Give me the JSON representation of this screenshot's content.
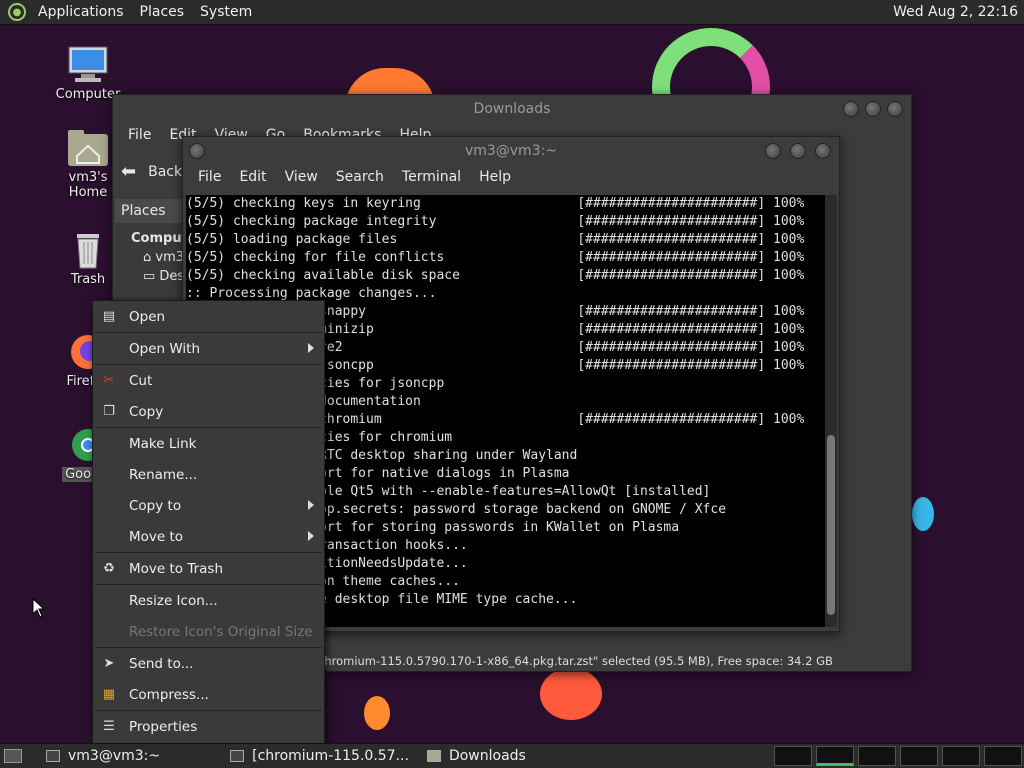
{
  "topbar": {
    "menus": [
      "Applications",
      "Places",
      "System"
    ],
    "clock": "Wed Aug  2, 22:16"
  },
  "desktop_icons": [
    {
      "label": "Computer",
      "icon": "computer-icon"
    },
    {
      "label": "vm3's Home",
      "icon": "home-folder-icon"
    },
    {
      "label": "Trash",
      "icon": "trash-icon"
    },
    {
      "label": "Firefox",
      "icon": "firefox-icon"
    },
    {
      "label": "Google",
      "icon": "chrome-icon"
    }
  ],
  "file_manager": {
    "title": "Downloads",
    "menu": [
      "File",
      "Edit",
      "View",
      "Go",
      "Bookmarks",
      "Help"
    ],
    "back_label": "Back",
    "side_header": "Places",
    "side_section": "Computer",
    "side_items": [
      "vm3",
      "Desktop"
    ],
    "status": "chromium-115.0.5790.170-1-x86_64.pkg.tar.zst\" selected (95.5 MB), Free space: 34.2 GB"
  },
  "terminal": {
    "title": "vm3@vm3:~",
    "menu": [
      "File",
      "Edit",
      "View",
      "Search",
      "Terminal",
      "Help"
    ],
    "lines": [
      "(5/5) checking keys in keyring                    [######################] 100%",
      "(5/5) checking package integrity                  [######################] 100%",
      "(5/5) loading package files                       [######################] 100%",
      "(5/5) checking for file conflicts                 [######################] 100%",
      "(5/5) checking available disk space               [######################] 100%",
      ":: Processing package changes...",
      "(1/5) installing snappy                           [######################] 100%",
      "(2/5) installing minizip                          [######################] 100%",
      "(3/5) installing re2                              [######################] 100%",
      "(4/5) installing jsoncpp                          [######################] 100%",
      "Optional dependencies for jsoncpp",
      "    jsoncpp-doc: documentation",
      "(5/5) installing chromium                         [######################] 100%",
      "Optional dependencies for chromium",
      "    pipewire: WebRTC desktop sharing under Wayland",
      "    kdialog: support for native dialogs in Plasma",
      "    qt5-base: enable Qt5 with --enable-features=AllowQt [installed]",
      "    org.freedesktop.secrets: password storage backend on GNOME / Xfce",
      "    kwallet: support for storing passwords in KWallet on Plasma",
      ":: Running post-transaction hooks...",
      "(1/3) Arming ConditionNeedsUpdate...",
      "(2/3) Updating icon theme caches...",
      "(3/3) Updating the desktop file MIME type cache..."
    ]
  },
  "context_menu": [
    {
      "label": "Open",
      "icon": "open-icon"
    },
    {
      "sep": true
    },
    {
      "label": "Open With",
      "submenu": true
    },
    {
      "sep": true
    },
    {
      "label": "Cut",
      "icon": "scissors-icon"
    },
    {
      "label": "Copy",
      "icon": "copy-icon"
    },
    {
      "sep": true
    },
    {
      "label": "Make Link"
    },
    {
      "label": "Rename..."
    },
    {
      "label": "Copy to",
      "submenu": true
    },
    {
      "label": "Move to",
      "submenu": true
    },
    {
      "sep": true
    },
    {
      "label": "Move to Trash",
      "icon": "trash-icon"
    },
    {
      "sep": true
    },
    {
      "label": "Resize Icon..."
    },
    {
      "label": "Restore Icon's Original Size",
      "disabled": true
    },
    {
      "sep": true
    },
    {
      "label": "Send to...",
      "icon": "send-icon"
    },
    {
      "label": "Compress...",
      "icon": "archive-icon"
    },
    {
      "sep": true
    },
    {
      "label": "Properties",
      "icon": "properties-icon"
    }
  ],
  "taskbar": {
    "tasks": [
      "vm3@vm3:~",
      "[chromium-115.0.57...",
      "Downloads"
    ]
  }
}
